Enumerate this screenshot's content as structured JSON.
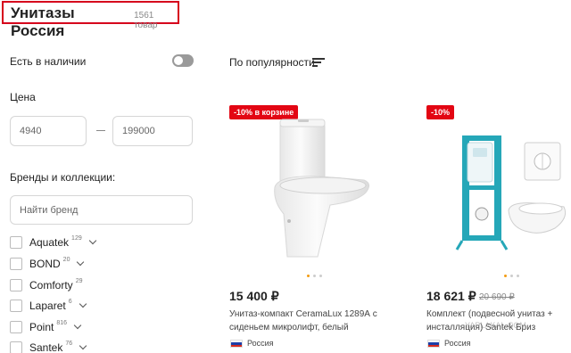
{
  "header": {
    "title": "Унитазы Россия",
    "count": "1561 товар"
  },
  "filters": {
    "in_stock_label": "Есть в наличии",
    "price_label": "Цена",
    "price_min": "4940",
    "price_max": "199000",
    "brands_label": "Бренды и коллекции:",
    "brand_search_placeholder": "Найти бренд",
    "brands": [
      {
        "name": "Aquatek",
        "count": "129"
      },
      {
        "name": "BOND",
        "count": "20"
      },
      {
        "name": "Comforty",
        "count": "29"
      },
      {
        "name": "Laparet",
        "count": "6"
      },
      {
        "name": "Point",
        "count": "816"
      },
      {
        "name": "Santek",
        "count": "76"
      }
    ]
  },
  "sort": {
    "label": "По популярности"
  },
  "products": [
    {
      "badge": "-10% в корзине",
      "price": "15 400 ₽",
      "old_price": "",
      "name_line1": "Унитаз-компакт CeramaLux 1289А с",
      "name_line2": "сиденьем микролифт, белый",
      "country": "Россия"
    },
    {
      "badge": "-10%",
      "price": "18 621 ₽",
      "old_price": "20 690 ₽",
      "name_line1": "Комплект (подвесной унитаз +",
      "name_line2": "инсталляция) Santek Бриз",
      "country": "Россия"
    }
  ],
  "watermark": "YAPLAKAL.COM",
  "colors": {
    "accent": "#e30613",
    "highlight_border": "#d6001c",
    "install_frame": "#25a7b8"
  }
}
